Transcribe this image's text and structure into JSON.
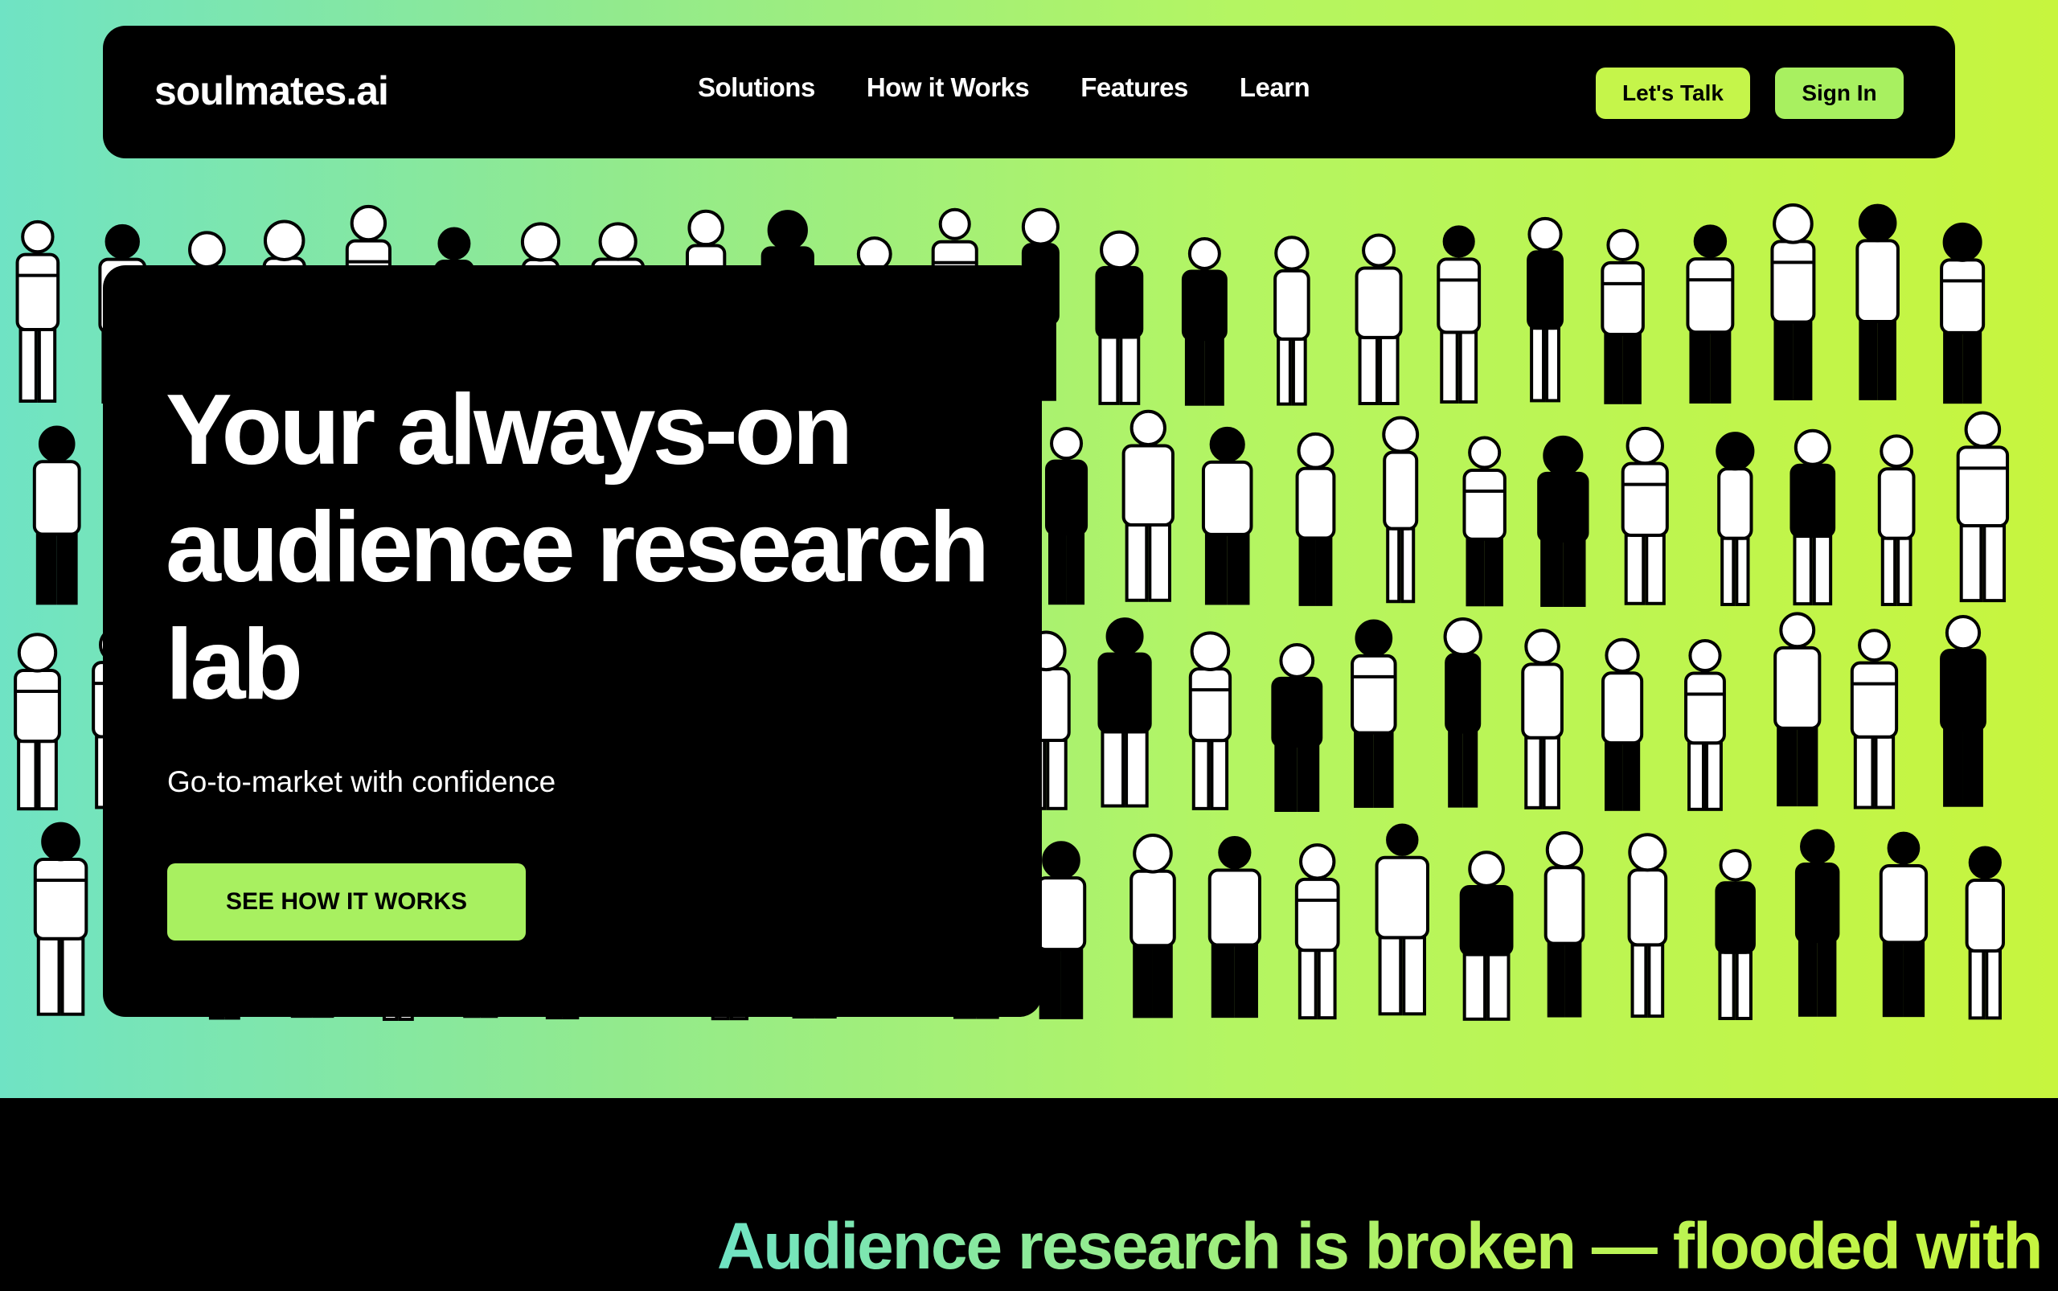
{
  "brand": {
    "logo_text": "soulmates.ai"
  },
  "nav": {
    "links": [
      "Solutions",
      "How it Works",
      "Features",
      "Learn"
    ],
    "talk_label": "Let's Talk",
    "signin_label": "Sign In"
  },
  "hero": {
    "title": "Your always-on audience research lab",
    "subtitle": "Go-to-market with confidence",
    "cta_label": "SEE HOW IT WORKS",
    "illustration": "crowd-of-doodle-people"
  },
  "section": {
    "headline": "Audience research is broken — flooded with"
  },
  "colors": {
    "gradient_start": "#6fe3c4",
    "gradient_end": "#c7f53e",
    "accent_button": "#c5f54a",
    "background_dark": "#000000"
  }
}
